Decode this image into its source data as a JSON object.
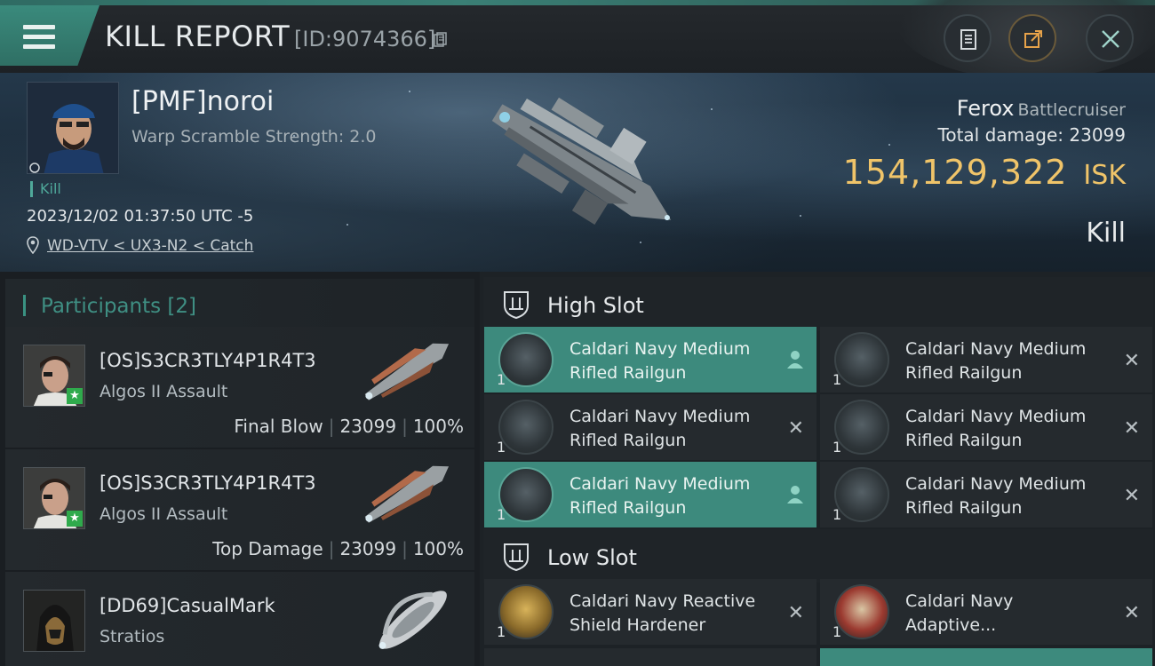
{
  "header": {
    "title": "KILL REPORT",
    "report_id": "[ID:9074366]"
  },
  "victim": {
    "name": "[PMF]noroi",
    "warp_scramble": "Warp Scramble Strength: 2.0",
    "kill_tag": "Kill",
    "timestamp": "2023/12/02 01:37:50 UTC -5",
    "location": "WD-VTV < UX3-N2 < Catch",
    "ship_name": "Ferox",
    "ship_class": "Battlecruiser",
    "total_damage_label": "Total damage:",
    "total_damage": "23099",
    "isk_value": "154,129,322",
    "isk_currency": "ISK",
    "result": "Kill"
  },
  "participants": {
    "title": "Participants [2]",
    "rows": [
      {
        "name": "[OS]S3CR3TLY4P1R4T3",
        "ship": "Algos II Assault",
        "role": "Final Blow",
        "damage": "23099",
        "percent": "100%"
      },
      {
        "name": "[OS]S3CR3TLY4P1R4T3",
        "ship": "Algos II Assault",
        "role": "Top Damage",
        "damage": "23099",
        "percent": "100%"
      },
      {
        "name": "[DD69]CasualMark",
        "ship": "Stratios"
      }
    ]
  },
  "fitting": {
    "high_slot_label": "High Slot",
    "low_slot_label": "Low Slot",
    "high_slot": [
      {
        "line1": "Caldari Navy Medium",
        "line2": "Rifled Railgun",
        "qty": "1"
      },
      {
        "line1": "Caldari Navy Medium",
        "line2": "Rifled Railgun",
        "qty": "1"
      },
      {
        "line1": "Caldari Navy Medium",
        "line2": "Rifled Railgun",
        "qty": "1"
      },
      {
        "line1": "Caldari Navy Medium",
        "line2": "Rifled Railgun",
        "qty": "1"
      },
      {
        "line1": "Caldari Navy Medium",
        "line2": "Rifled Railgun",
        "qty": "1"
      },
      {
        "line1": "Caldari Navy Medium",
        "line2": "Rifled Railgun",
        "qty": "1"
      }
    ],
    "low_slot": [
      {
        "line1": "Caldari Navy Reactive",
        "line2": "Shield Hardener",
        "qty": "1"
      },
      {
        "line1": "Caldari Navy",
        "line2": "Adaptive...",
        "qty": "1"
      }
    ]
  },
  "colors": {
    "accent": "#3d8a7d",
    "isk": "#f0c469",
    "corp_badge": "#2faa4c"
  }
}
